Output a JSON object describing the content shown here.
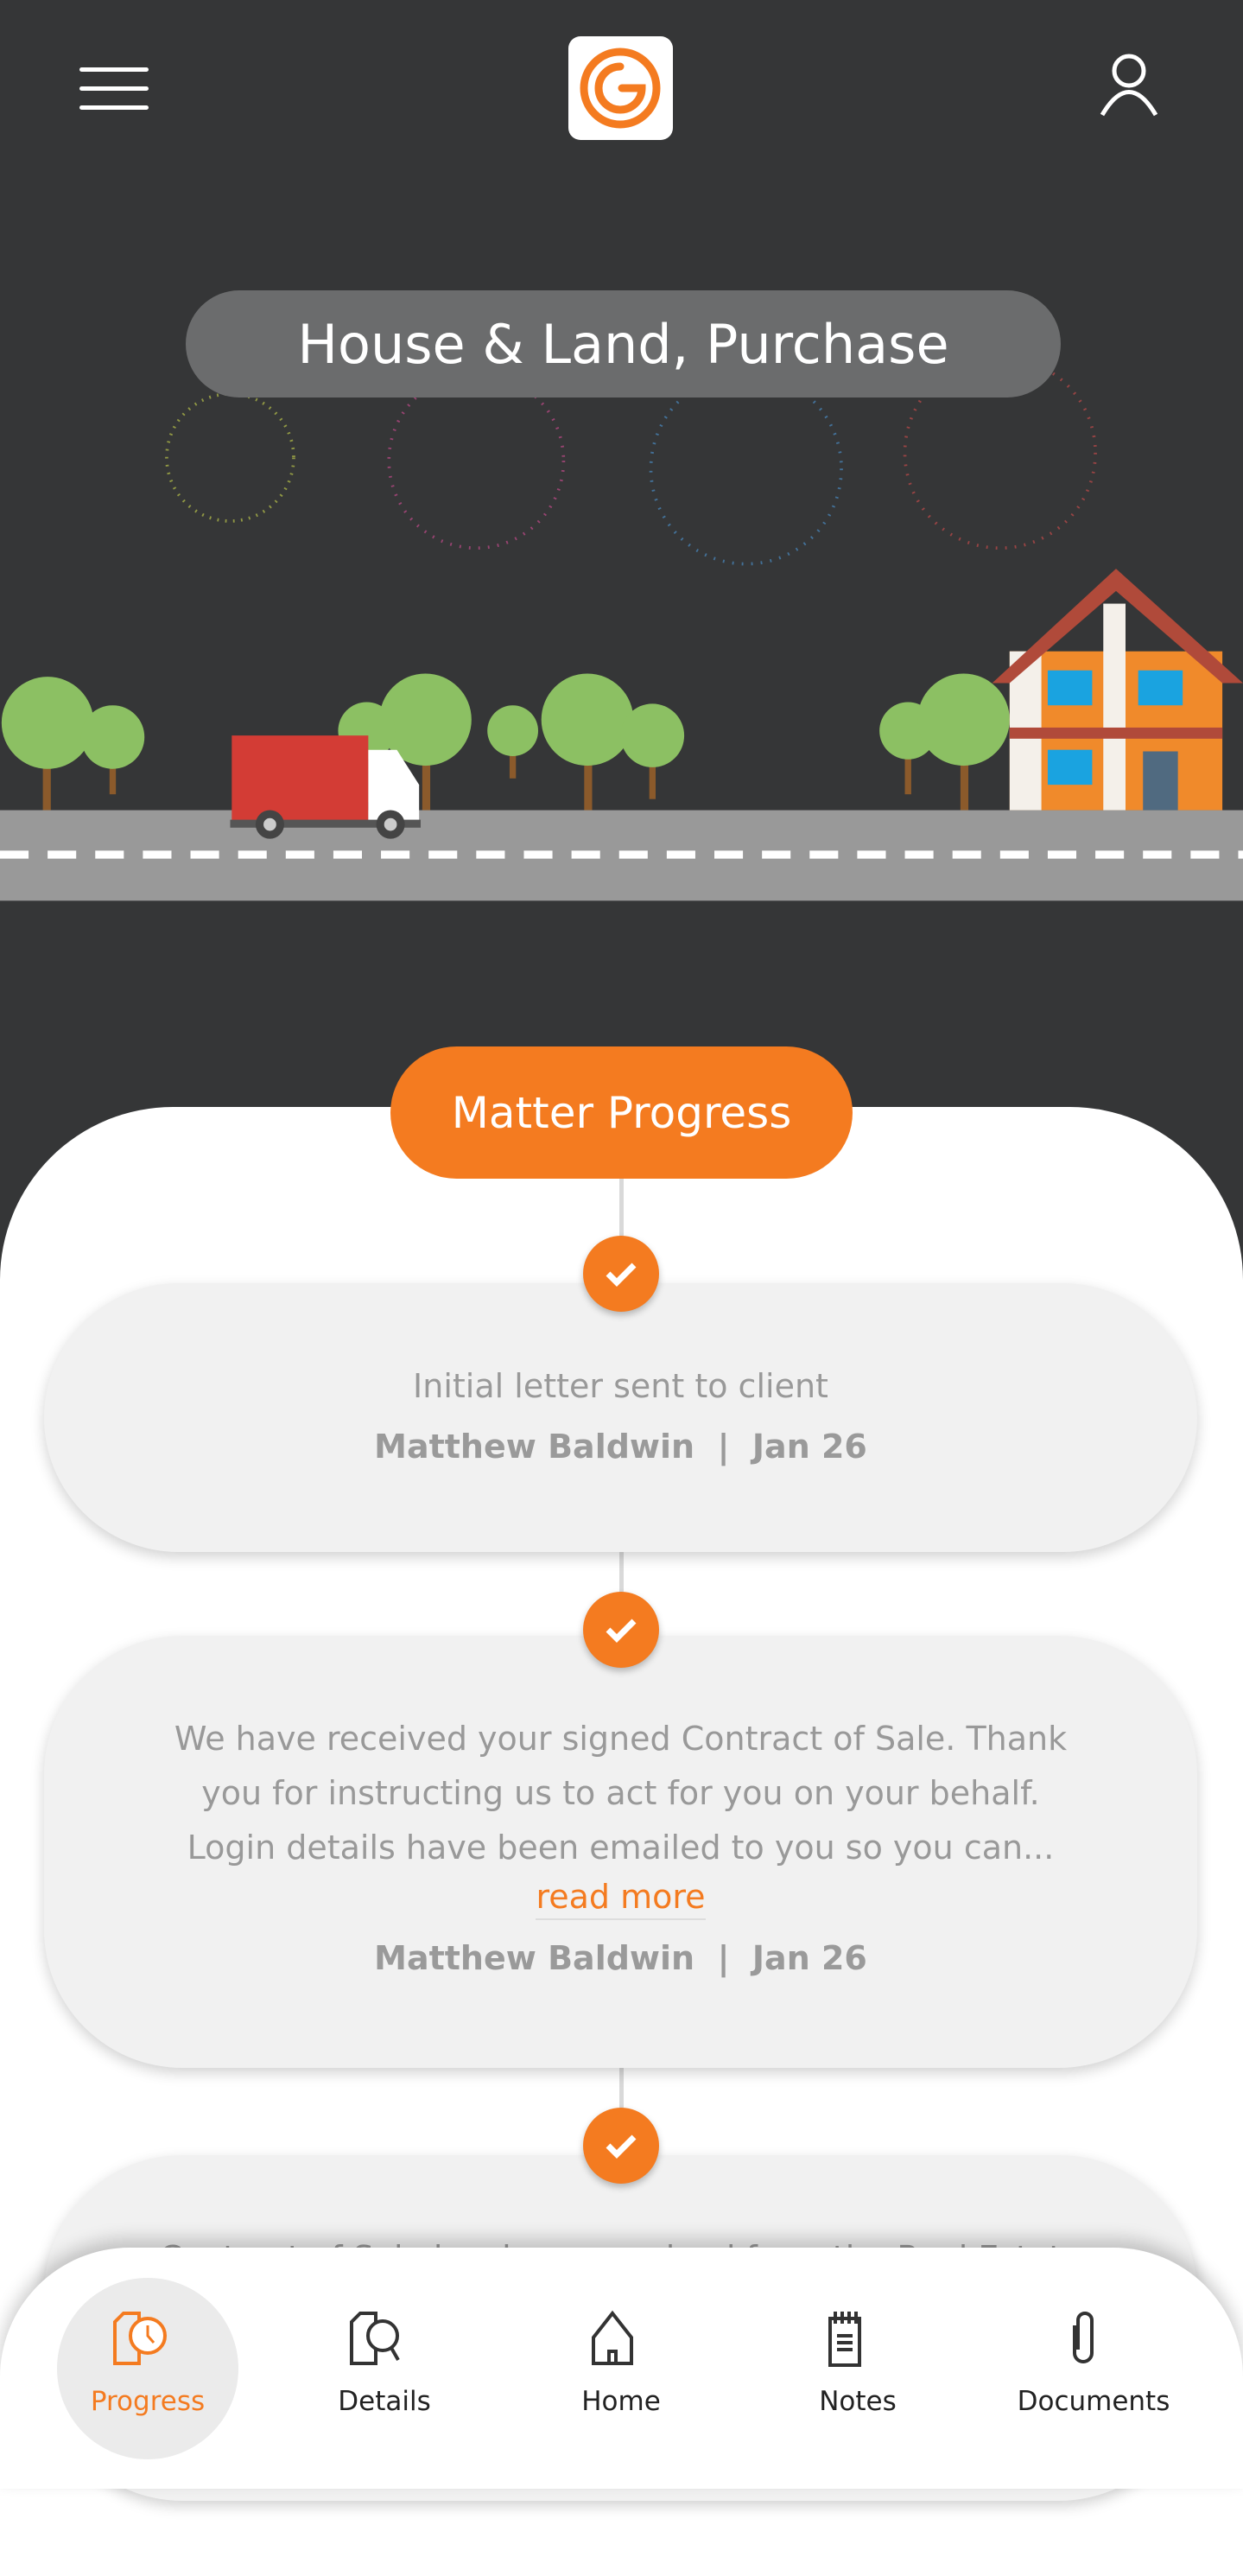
{
  "header": {
    "menu_icon": "hamburger-icon",
    "logo_icon": "brand-g-logo",
    "profile_icon": "user-icon"
  },
  "matter": {
    "title": "House & Land, Purchase"
  },
  "progress": {
    "label": "Matter Progress",
    "accent": "#f47b20",
    "items": [
      {
        "text": "Initial letter sent to client",
        "author": "Matthew Baldwin",
        "date": "Jan 26"
      },
      {
        "text": "We have received your signed Contract of Sale. Thank you for instructing us to act for you on your behalf. Login details have been emailed to you so you can...",
        "line1": "We have received your signed Contract of Sale. Thank",
        "line2": "you for instructing us to act for you on your behalf.",
        "line3": "Login details have been emailed to you so you can...",
        "read_more": "read more",
        "author": "Matthew Baldwin",
        "date": "Jan 26"
      },
      {
        "text": "Contract of Sale has been received from the Real Estate"
      }
    ]
  },
  "nav": {
    "items": [
      {
        "label": "Progress",
        "icon": "progress-clock-icon",
        "active": true
      },
      {
        "label": "Details",
        "icon": "details-search-icon"
      },
      {
        "label": "Home",
        "icon": "home-icon"
      },
      {
        "label": "Notes",
        "icon": "notes-icon"
      },
      {
        "label": "Documents",
        "icon": "paperclip-icon"
      }
    ]
  }
}
